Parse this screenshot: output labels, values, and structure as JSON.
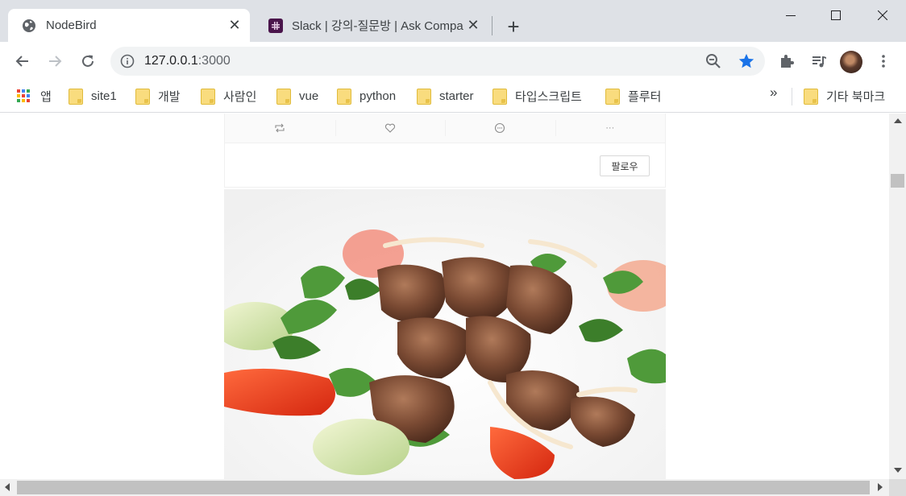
{
  "tabs": [
    {
      "title": "NodeBird",
      "favicon": "globe-icon",
      "active": true
    },
    {
      "title": "Slack | 강의-질문방 | Ask Compa",
      "favicon": "slack-icon",
      "active": false
    }
  ],
  "toolbar": {
    "url_host": "127.0.0.1",
    "url_port": ":3000",
    "star_color": "#1a73e8"
  },
  "bookmarks": {
    "apps_label": "앱",
    "items": [
      "site1",
      "개발",
      "사람인",
      "vue",
      "python",
      "starter",
      "타입스크립트",
      "플루터"
    ],
    "overflow_label": "»",
    "other_label": "기타 북마크"
  },
  "post": {
    "follow_label": "팔로우",
    "action_icons": [
      "retweet-icon",
      "heart-icon",
      "message-icon",
      "ellipsis-icon"
    ],
    "ellipsis_glyph": "···",
    "image": "steak-salad-photo"
  }
}
